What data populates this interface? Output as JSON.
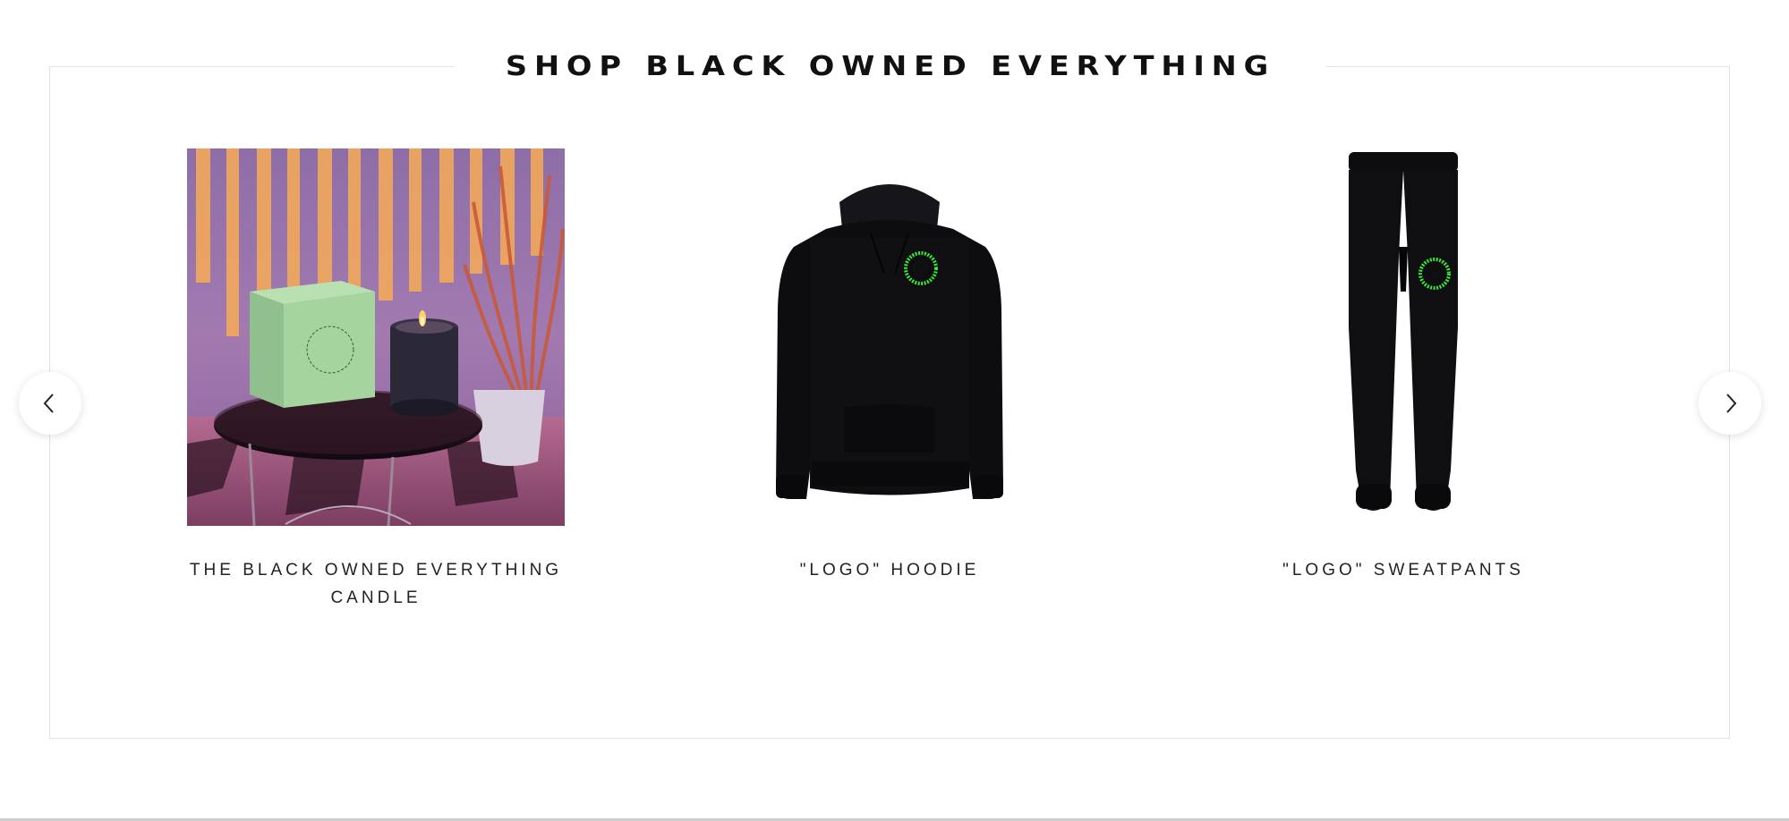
{
  "section": {
    "title": "SHOP BLACK OWNED EVERYTHING"
  },
  "carousel": {
    "prev_icon": "chevron-left-icon",
    "next_icon": "chevron-right-icon",
    "products": [
      {
        "name": "THE BLACK OWNED EVERYTHING CANDLE",
        "image": "candle-product-photo"
      },
      {
        "name": "\"LOGO\" HOODIE",
        "image": "hoodie-product-photo"
      },
      {
        "name": "\"LOGO\" SWEATPANTS",
        "image": "sweatpants-product-photo"
      }
    ]
  },
  "colors": {
    "title_text": "#111111",
    "product_text": "#222222",
    "logo_green": "#39e639",
    "garment_black": "#0d0d0f",
    "frame_border": "#e2e2e2"
  }
}
